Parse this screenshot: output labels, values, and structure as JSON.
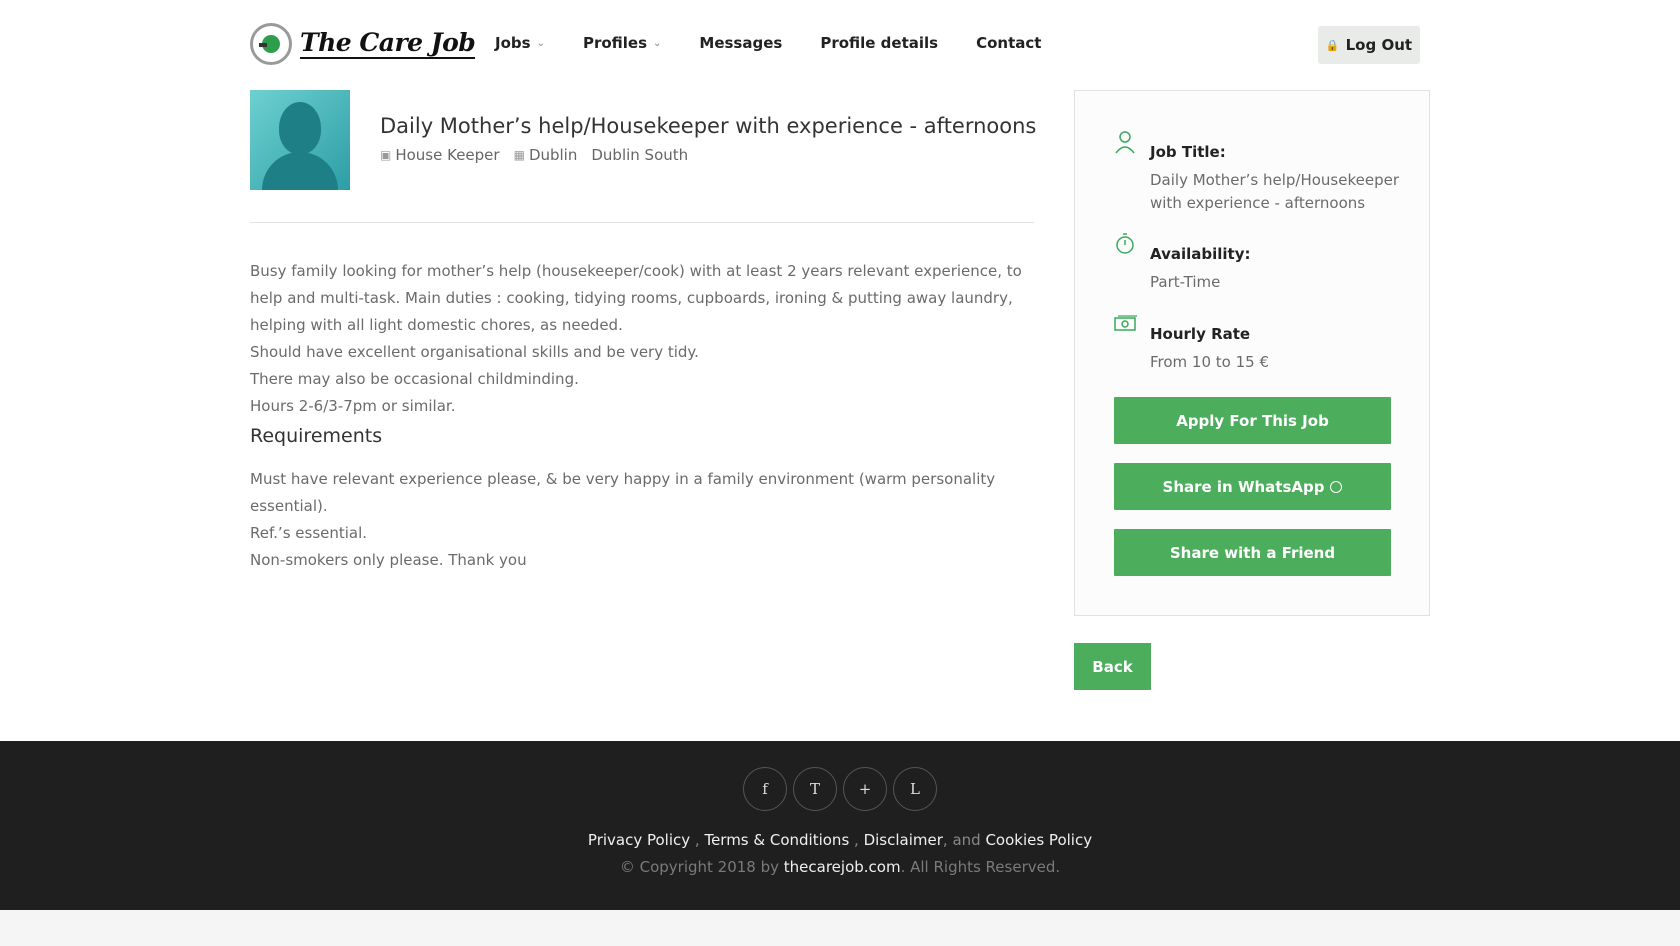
{
  "brand": {
    "name": "The Care Job"
  },
  "nav": {
    "items": [
      {
        "label": "Jobs",
        "dropdown": true
      },
      {
        "label": "Profiles",
        "dropdown": true
      },
      {
        "label": "Messages",
        "dropdown": false
      },
      {
        "label": "Profile details",
        "dropdown": false
      },
      {
        "label": "Contact",
        "dropdown": false
      }
    ],
    "logout_label": "Log Out"
  },
  "job": {
    "title": "Daily Mother’s help/Housekeeper with experience - afternoons",
    "category": "House Keeper",
    "city": "Dublin",
    "area": "Dublin South",
    "description": [
      "Busy family looking for mother’s help (housekeeper/cook) with at least 2 years relevant experience, to help and multi-task.  Main duties : cooking, tidying rooms, cupboards, ironing & putting away laundry, helping with all light domestic chores, as needed.",
      "Should have excellent organisational skills and be very tidy.",
      "There may also be occasional childminding.",
      "Hours 2-6/3-7pm or similar."
    ],
    "requirements_heading": "Requirements",
    "requirements": [
      "Must have relevant experience please, & be very happy in a family environment (warm personality essential).",
      "Ref.’s essential.",
      "Non-smokers only please.   Thank you"
    ]
  },
  "sidebar": {
    "job_title_label": "Job Title:",
    "job_title_value": "Daily Mother’s help/Housekeeper with experience - afternoons",
    "availability_label": "Availability:",
    "availability_value": "Part-Time",
    "rate_label": "Hourly Rate",
    "rate_value": "From 10 to 15 €",
    "apply_label": "Apply For This Job",
    "whatsapp_label": "Share in WhatsApp",
    "share_friend_label": "Share with a Friend"
  },
  "back_label": "Back",
  "footer": {
    "social": [
      "f",
      "T",
      "+",
      "L"
    ],
    "privacy": "Privacy Policy",
    "sep1": " , ",
    "terms": "Terms & Conditions",
    "sep2": " , ",
    "disclaimer": "Disclaimer",
    "and": ", and ",
    "cookies": "Cookies Policy",
    "copyright_prefix": "© Copyright 2018 by ",
    "site": "thecarejob.com",
    "copyright_suffix": ". All Rights Reserved.",
    "icons": [
      "facebook-icon",
      "twitter-icon",
      "google-plus-icon",
      "linkedin-icon"
    ]
  },
  "colors": {
    "accent": "#4cad5c",
    "footer_bg": "#1f1f1f"
  }
}
